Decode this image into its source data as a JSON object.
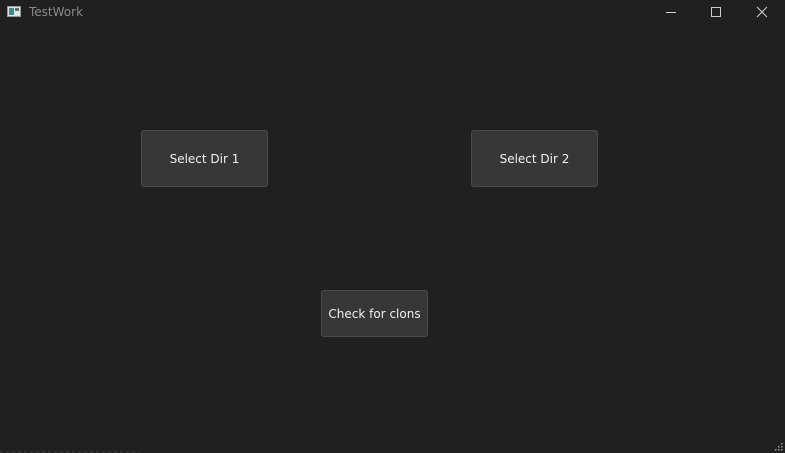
{
  "window": {
    "title": "TestWork",
    "icon": "app-window-icon"
  },
  "caption": {
    "minimize_icon": "minimize-icon",
    "maximize_icon": "maximize-icon",
    "close_icon": "close-icon"
  },
  "main": {
    "select_dir1_label": "Select Dir 1",
    "select_dir2_label": "Select Dir 2",
    "check_label": "Check for clons"
  },
  "colors": {
    "background": "#202020",
    "button_bg": "#373737",
    "button_border": "#4a4a4a",
    "text": "#f0f0f0"
  }
}
